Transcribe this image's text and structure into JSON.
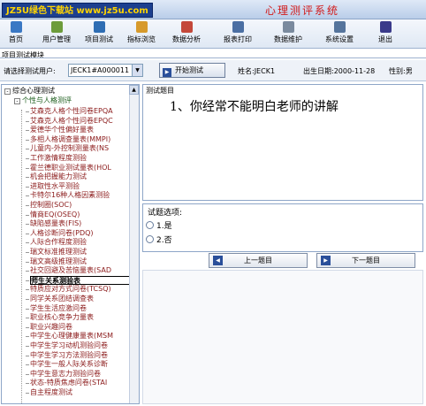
{
  "header": {
    "logo": "JZ5U绿色下载站 www.jz5u.com",
    "app_title": "心理测评系统"
  },
  "toolbar": {
    "items": [
      {
        "label": "首页",
        "icon": "home-icon",
        "color": "#3a78c4"
      },
      {
        "label": "用户管理",
        "icon": "users-icon",
        "color": "#6d9c3b"
      },
      {
        "label": "项目测试",
        "icon": "test-icon",
        "color": "#2e6db3"
      },
      {
        "label": "指标浏览",
        "icon": "browse-icon",
        "color": "#d79a2b"
      },
      {
        "label": "数据分析",
        "icon": "analysis-icon",
        "color": "#c4483a"
      },
      {
        "label": "报表打印",
        "icon": "print-icon",
        "color": "#4b6fa3"
      },
      {
        "label": "数据维护",
        "icon": "maintenance-icon",
        "color": "#7a8a9e"
      },
      {
        "label": "系统设置",
        "icon": "settings-icon",
        "color": "#55749c"
      },
      {
        "label": "退出",
        "icon": "exit-icon",
        "color": "#3a3a8a"
      }
    ]
  },
  "module_label": "项目测试模块",
  "userbar": {
    "select_label": "请选择测试用户:",
    "selected_user": "JECK1#A000011",
    "start_button": "开始测试",
    "name_label": "姓名:JECK1",
    "birth_label": "出生日期:2000-11-28",
    "gender_label": "性别:男"
  },
  "tree": {
    "root": "综合心理测试",
    "group": "个性与人格测评",
    "items": [
      "艾森克人格个性问卷EPQA",
      "艾森克人格个性问卷EPQC",
      "爱德华个性偏好量表",
      "多相人格调查量表(MMPI)",
      "儿童内-外控制测量表(NS",
      "工作激情程度测验",
      "霍兰德职业测试量表(HOL",
      "机会把握能力测试",
      "进取性水平测验",
      "卡特尔16种人格因素测验",
      "控制圈(SOC)",
      "情商EQ(OSEQ)",
      "缺陷感量表(FIS)",
      "人格诊断问卷(PDQ)",
      "人际合作程度测验",
      "瑞文标准推理测试",
      "瑞文高级推理测试",
      "社交回避及苦恼量表(SAD",
      "师生关系测验表",
      "特质应对方式问卷(TCSQ)",
      "同学关系团结调查表",
      "学生生活应激问卷",
      "职业核心竞争力量表",
      "职业兴趣问卷",
      "中学生心理健康量表(MSM",
      "中学生学习动机测验问卷",
      "中学生学习方法测验问卷",
      "中学生一般人际关系诊断",
      "中学生意志力测验问卷",
      "状态-特质焦虑问卷(STAI",
      "自主程度测试"
    ],
    "selected_index": 18
  },
  "question": {
    "legend": "测试题目",
    "text": "1、你经常不能明白老师的讲解"
  },
  "options": {
    "legend": "试题选项:",
    "items": [
      "1.是",
      "2.否"
    ]
  },
  "nav": {
    "prev": "上一题目",
    "next": "下一题目"
  }
}
